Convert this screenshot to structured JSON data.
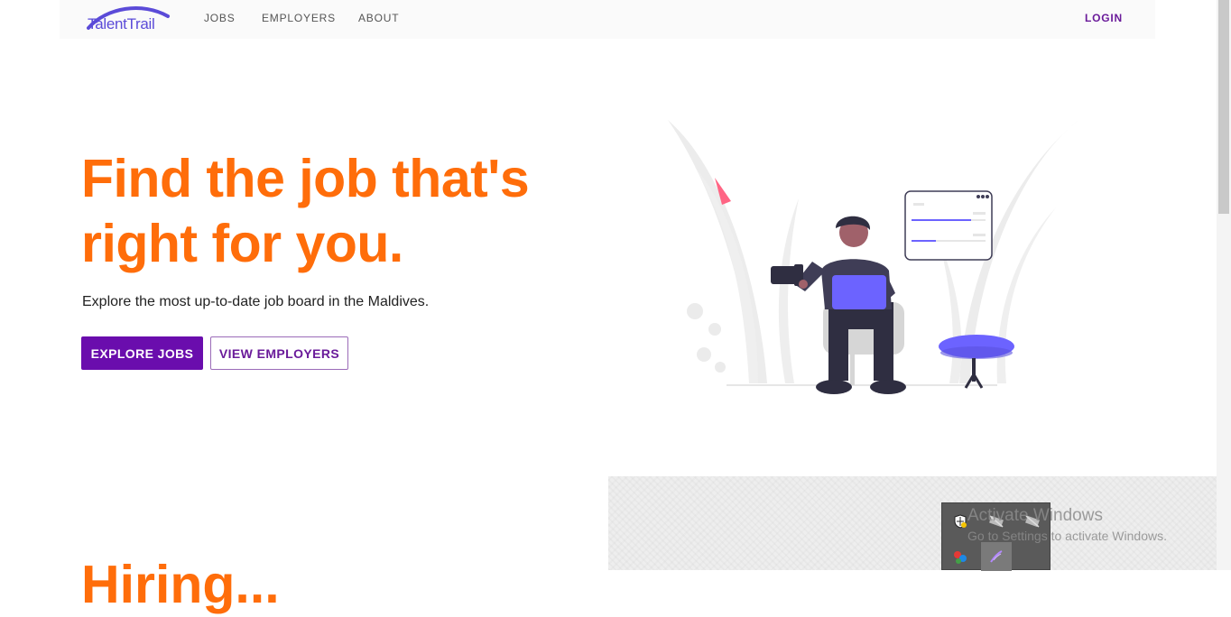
{
  "navbar": {
    "logo_text": "TalentTrail",
    "links": [
      "JOBS",
      "EMPLOYERS",
      "ABOUT"
    ],
    "login_label": "LOGIN"
  },
  "hero": {
    "title_line1": "Find the job that's",
    "title_line2": "right for you.",
    "subtitle": "Explore the most up-to-date job board in the Maldives.",
    "primary_button": "EXPLORE JOBS",
    "secondary_button": "VIEW EMPLOYERS"
  },
  "section": {
    "title_partial": "Hiring..."
  },
  "system": {
    "watermark_title": "Activate Windows",
    "watermark_sub": "Go to Settings to activate Windows."
  },
  "colors": {
    "accent_orange": "#ff6d0a",
    "brand_purple": "#6a0dad",
    "illustration_purple": "#6c63ff"
  }
}
